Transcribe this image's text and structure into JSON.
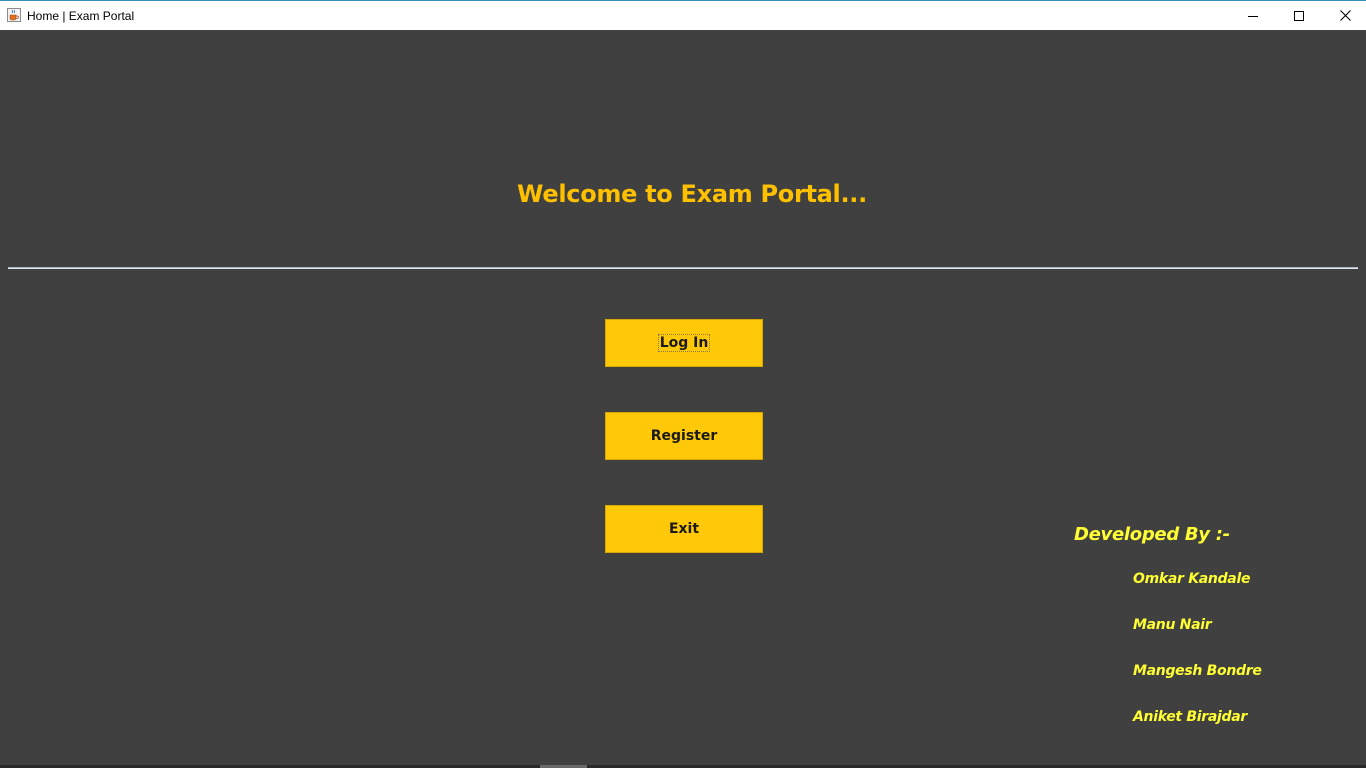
{
  "window": {
    "title": "Home | Exam Portal",
    "icon": "java-coffee-cup-icon"
  },
  "main": {
    "welcome_text": "Welcome to Exam Portal...",
    "buttons": {
      "login": "Log In",
      "register": "Register",
      "exit": "Exit"
    }
  },
  "credits": {
    "heading": "Developed By :-",
    "developers": [
      "Omkar Kandale",
      "Manu Nair",
      "Mangesh Bondre",
      "Aniket Birajdar"
    ]
  },
  "colors": {
    "background": "#404040",
    "accent": "#ffc000",
    "button": "#ffc808",
    "credit_text": "#ffff33"
  }
}
